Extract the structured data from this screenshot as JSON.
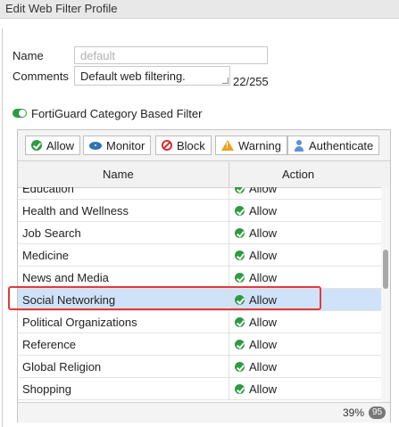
{
  "window": {
    "title": "Edit Web Filter Profile"
  },
  "form": {
    "name_label": "Name",
    "name_placeholder": "default",
    "comments_label": "Comments",
    "comments_value": "Default web filtering.",
    "comments_counter": "22/255"
  },
  "section": {
    "title": "FortiGuard Category Based Filter",
    "toggle_on": true
  },
  "toolbar": {
    "allow": "Allow",
    "monitor": "Monitor",
    "block": "Block",
    "warning": "Warning",
    "authenticate": "Authenticate"
  },
  "table": {
    "columns": [
      "Name",
      "Action"
    ],
    "rows": [
      {
        "name": "Education",
        "action": "Allow"
      },
      {
        "name": "Health and Wellness",
        "action": "Allow"
      },
      {
        "name": "Job Search",
        "action": "Allow"
      },
      {
        "name": "Medicine",
        "action": "Allow"
      },
      {
        "name": "News and Media",
        "action": "Allow"
      },
      {
        "name": "Social Networking",
        "action": "Allow",
        "selected": true
      },
      {
        "name": "Political Organizations",
        "action": "Allow"
      },
      {
        "name": "Reference",
        "action": "Allow"
      },
      {
        "name": "Global Religion",
        "action": "Allow"
      },
      {
        "name": "Shopping",
        "action": "Allow"
      }
    ]
  },
  "footer": {
    "percent": "39%",
    "count": "95"
  },
  "colors": {
    "allow": "#2e9a42",
    "selected_row": "#cfe2f8",
    "highlight": "#e23b3b"
  }
}
